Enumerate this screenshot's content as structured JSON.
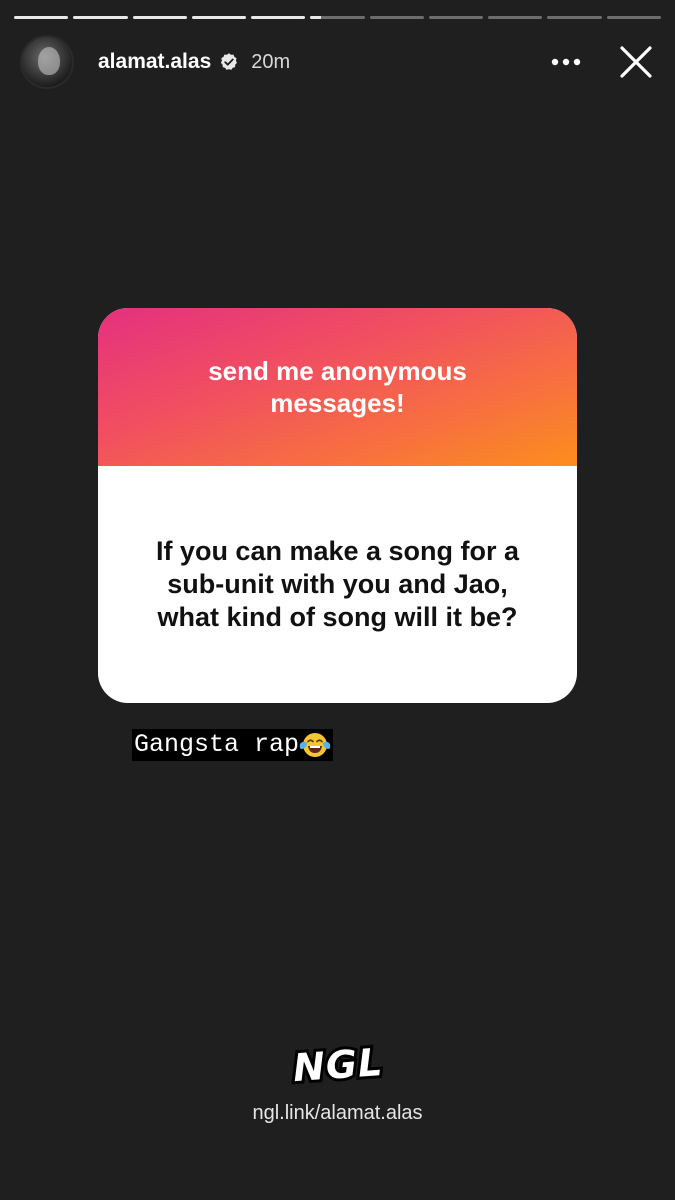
{
  "story": {
    "progress_segments": [
      1,
      1,
      1,
      1,
      1,
      0.2,
      0,
      0,
      0,
      0,
      0
    ]
  },
  "header": {
    "username": "alamat.alas",
    "time_ago": "20m",
    "verified": true,
    "more_icon": "more-horizontal-icon",
    "close_icon": "close-icon"
  },
  "question_card": {
    "title": "send me anonymous messages!",
    "question": "If you can make a song for a sub-unit with you and Jao, what kind of song will it be?",
    "gradient_colors": [
      "#e5307f",
      "#f8733c",
      "#fb8e1c"
    ]
  },
  "reply": {
    "text": "Gangsta rap",
    "emoji": "face-with-tears-of-joy"
  },
  "footer": {
    "logo_text": "NGL",
    "link": "ngl.link/alamat.alas"
  }
}
